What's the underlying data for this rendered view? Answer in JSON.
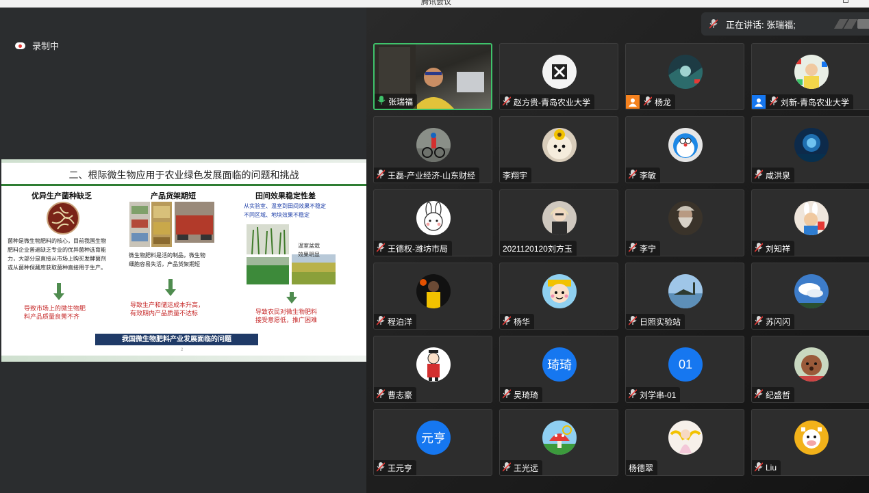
{
  "window": {
    "title": "腾讯会议"
  },
  "share": {
    "recording_label": "录制中",
    "slide": {
      "title": "二、根际微生物应用于农业绿色发展面临的问题和挑战",
      "columns": [
        {
          "heading": "优异生产菌种缺乏",
          "body": [
            "菌种是微生物肥料的核心，目前我国生物",
            "肥料企业普遍缺乏专业的优异菌种选育能",
            "力，大部分是直接从市场上购买发酵菌剂",
            "或从菌种保藏库获取菌种直接用于生产。"
          ],
          "consequence": [
            "导致市场上的微生物肥",
            "料产品质量良莠不齐"
          ]
        },
        {
          "heading": "产品货架期短",
          "body": [
            "微生物肥料是活的制品，微生物",
            "细胞容易失活，产品货架期短"
          ],
          "consequence": [
            "导致生产和储运成本升高，",
            "有效期内产品质量不达标"
          ]
        },
        {
          "heading": "田间效果稳定性差",
          "intro": [
            "从实验室、温室到田间效果不稳定",
            "不同区域、地块效果不稳定"
          ],
          "photo_caption": [
            "温室盆栽",
            "效果明显"
          ],
          "consequence": [
            "导致农民对微生物肥料",
            "接受意愿低，推广困难"
          ]
        }
      ],
      "banner": "我国微生物肥料产业发展面临的问题",
      "page_number": "2"
    }
  },
  "speaking": {
    "label": "正在讲话: 张瑞福;"
  },
  "participants": [
    {
      "name": "张瑞福",
      "mic": "active",
      "active": true,
      "video": true
    },
    {
      "name": "赵方贵-青岛农业大学",
      "mic": "muted",
      "avatar": "calligraphy"
    },
    {
      "name": "杨龙",
      "mic": "muted",
      "avatar": "landscape-dark",
      "profile_badge": "#f5821f"
    },
    {
      "name": "刘新-青岛农业大学",
      "mic": "muted",
      "avatar": "toddler-toys",
      "profile_badge": "#1677f0"
    },
    {
      "name": "王磊-产业经济-山东财经",
      "mic": "muted",
      "avatar": "cyclist"
    },
    {
      "name": "李翔宇",
      "mic": "none",
      "avatar": "pomeranian"
    },
    {
      "name": "李敏",
      "mic": "muted",
      "avatar": "doraemon"
    },
    {
      "name": "咸洪泉",
      "mic": "muted",
      "avatar": "night-tree"
    },
    {
      "name": "王德权-潍坊市局",
      "mic": "muted",
      "avatar": "bunny-cartoon"
    },
    {
      "name": "2021120120刘方玉",
      "mic": "none",
      "avatar": "woman-portrait"
    },
    {
      "name": "李宁",
      "mic": "muted",
      "avatar": "old-wizard"
    },
    {
      "name": "刘知祥",
      "mic": "muted",
      "avatar": "kid-with-rabbit"
    },
    {
      "name": "程泊洋",
      "mic": "muted",
      "avatar": "basketball-player"
    },
    {
      "name": "杨华",
      "mic": "muted",
      "avatar": "cartoon-boy-hat"
    },
    {
      "name": "日照实验站",
      "mic": "muted",
      "avatar": "lake-tree"
    },
    {
      "name": "苏闪闪",
      "mic": "muted",
      "avatar": "blue-sky"
    },
    {
      "name": "曹志豪",
      "mic": "muted",
      "avatar": "cartoon-red-coat"
    },
    {
      "name": "吴琦琦",
      "mic": "muted",
      "avatar_text": "琦琦"
    },
    {
      "name": "刘学串-01",
      "mic": "muted",
      "avatar_text": "01"
    },
    {
      "name": "纪盛哲",
      "mic": "muted",
      "avatar": "poodle"
    },
    {
      "name": "王元亨",
      "mic": "muted",
      "avatar_text": "元亨"
    },
    {
      "name": "王光远",
      "mic": "muted",
      "avatar": "snail-mushroom"
    },
    {
      "name": "杨德翠",
      "mic": "none",
      "avatar": "angel-figure"
    },
    {
      "name": "Liu",
      "mic": "muted",
      "avatar": "cartoon-cow"
    }
  ],
  "colors": {
    "speaking_green": "#3fc36b",
    "muted_red": "#e53935",
    "avatar_blue": "#1677f0",
    "slide_green": "#2e7d32",
    "banner_navy": "#1f3a67"
  }
}
